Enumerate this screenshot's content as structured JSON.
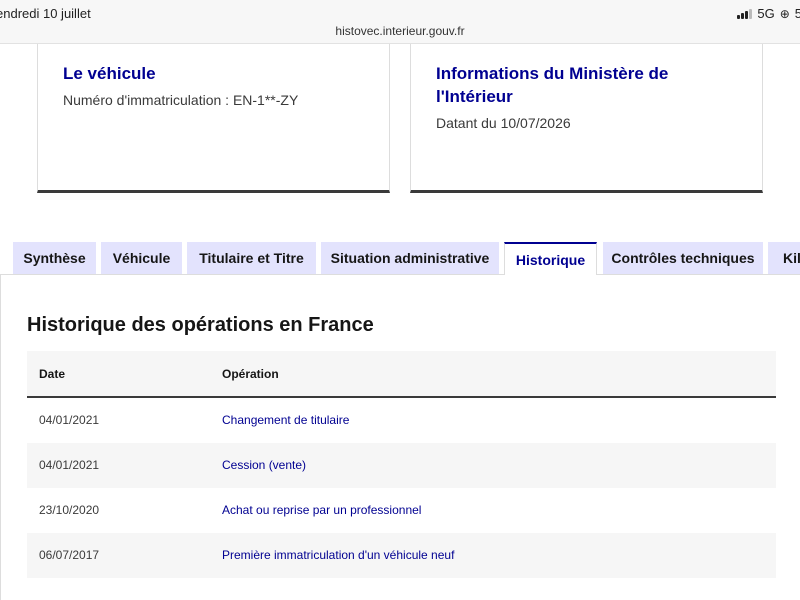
{
  "status_bar": {
    "date": "endredi 10 juillet",
    "network": "5G",
    "battery": "5"
  },
  "browser": {
    "url": "histovec.interieur.gouv.fr"
  },
  "cards": [
    {
      "title": "Le véhicule",
      "subtitle": "Numéro d'immatriculation : EN-1**-ZY"
    },
    {
      "title": "Informations du Ministère de l'Intérieur",
      "subtitle": "Datant du 10/07/2026"
    }
  ],
  "tabs": [
    {
      "label": "Synthèse",
      "active": false
    },
    {
      "label": "Véhicule",
      "active": false
    },
    {
      "label": "Titulaire et Titre",
      "active": false
    },
    {
      "label": "Situation administrative",
      "active": false
    },
    {
      "label": "Historique",
      "active": true
    },
    {
      "label": "Contrôles techniques",
      "active": false
    },
    {
      "label": "Kil",
      "active": false
    }
  ],
  "history": {
    "title": "Historique des opérations en France",
    "columns": [
      "Date",
      "Opération"
    ],
    "rows": [
      {
        "date": "04/01/2021",
        "operation": "Changement de titulaire"
      },
      {
        "date": "04/01/2021",
        "operation": "Cession (vente)"
      },
      {
        "date": "23/10/2020",
        "operation": "Achat ou reprise par un professionnel"
      },
      {
        "date": "06/07/2017",
        "operation": "Première immatriculation d'un véhicule neuf"
      }
    ]
  },
  "colors": {
    "accent": "#000091",
    "tab_bg": "#e3e3fd",
    "row_alt": "#f6f6f6"
  }
}
